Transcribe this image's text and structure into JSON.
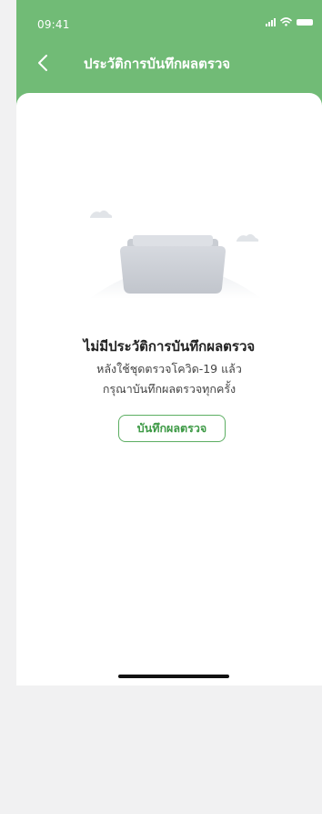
{
  "status_bar": {
    "time": "09:41",
    "icons": [
      "signal-icon",
      "wifi-icon",
      "battery-icon"
    ]
  },
  "header": {
    "title": "ประวัติการบันทึกผลตรวจ",
    "back_icon": "chevron-left-icon",
    "background_color": "#71bb76"
  },
  "empty_state": {
    "illustration": "folder-illustration",
    "title": "ไม่มีประวัติการบันทึกผลตรวจ",
    "description_line1": "หลังใช้ชุดตรวจโควิด-19 แล้ว",
    "description_line2": "กรุณาบันทึกผลตรวจทุกครั้ง",
    "button_label": "บันทึกผลตรวจ",
    "accent_color": "#5cae62"
  }
}
